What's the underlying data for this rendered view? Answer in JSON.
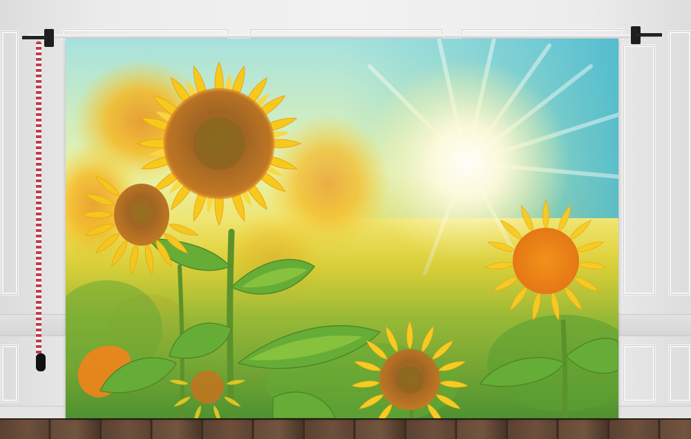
{
  "scene": {
    "subject": "sunflower-photo-backdrop",
    "colors": {
      "sky_top": "#5ec8d8",
      "sun_glow": "#fffbe0",
      "petal": "#f7c611",
      "petal_dark": "#e8a008",
      "disk": "#a0521a",
      "disk_center": "#6e4a12",
      "leaf": "#4f9a2a",
      "leaf_light": "#8cc83c",
      "wall": "#ececec",
      "floor": "#5a4132",
      "chain_red": "#c23b4a"
    },
    "icons": [
      "backdrop-clamp-icon",
      "counterweight-chain-icon"
    ]
  }
}
